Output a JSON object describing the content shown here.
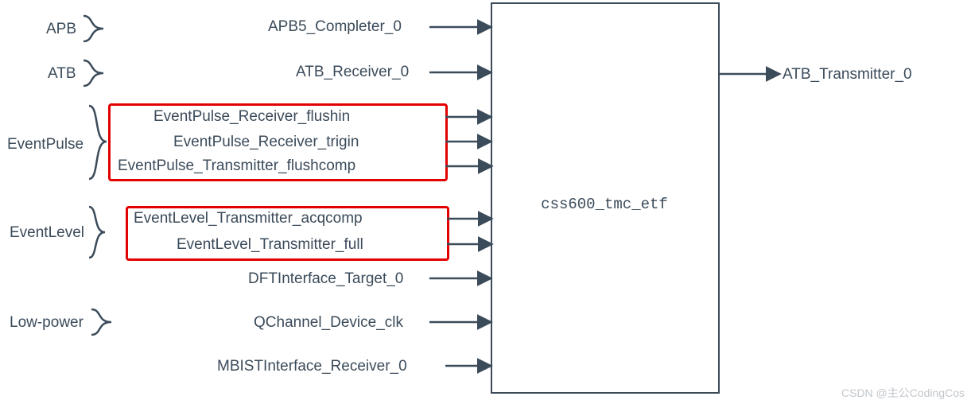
{
  "groups": {
    "apb": "APB",
    "atb": "ATB",
    "eventpulse": "EventPulse",
    "eventlevel": "EventLevel",
    "lowpower": "Low-power"
  },
  "signals": {
    "apb5": "APB5_Completer_0",
    "atbrx": "ATB_Receiver_0",
    "ep_flushin": "EventPulse_Receiver_flushin",
    "ep_trigin": "EventPulse_Receiver_trigin",
    "ep_flushcomp": "EventPulse_Transmitter_flushcomp",
    "el_acqcomp": "EventLevel_Transmitter_acqcomp",
    "el_full": "EventLevel_Transmitter_full",
    "dft": "DFTInterface_Target_0",
    "qchan": "QChannel_Device_clk",
    "mbist": "MBISTInterface_Receiver_0",
    "atbtx": "ATB_Transmitter_0"
  },
  "block": {
    "label": "css600_tmc_etf"
  },
  "watermark": "CSDN @主公CodingCos"
}
